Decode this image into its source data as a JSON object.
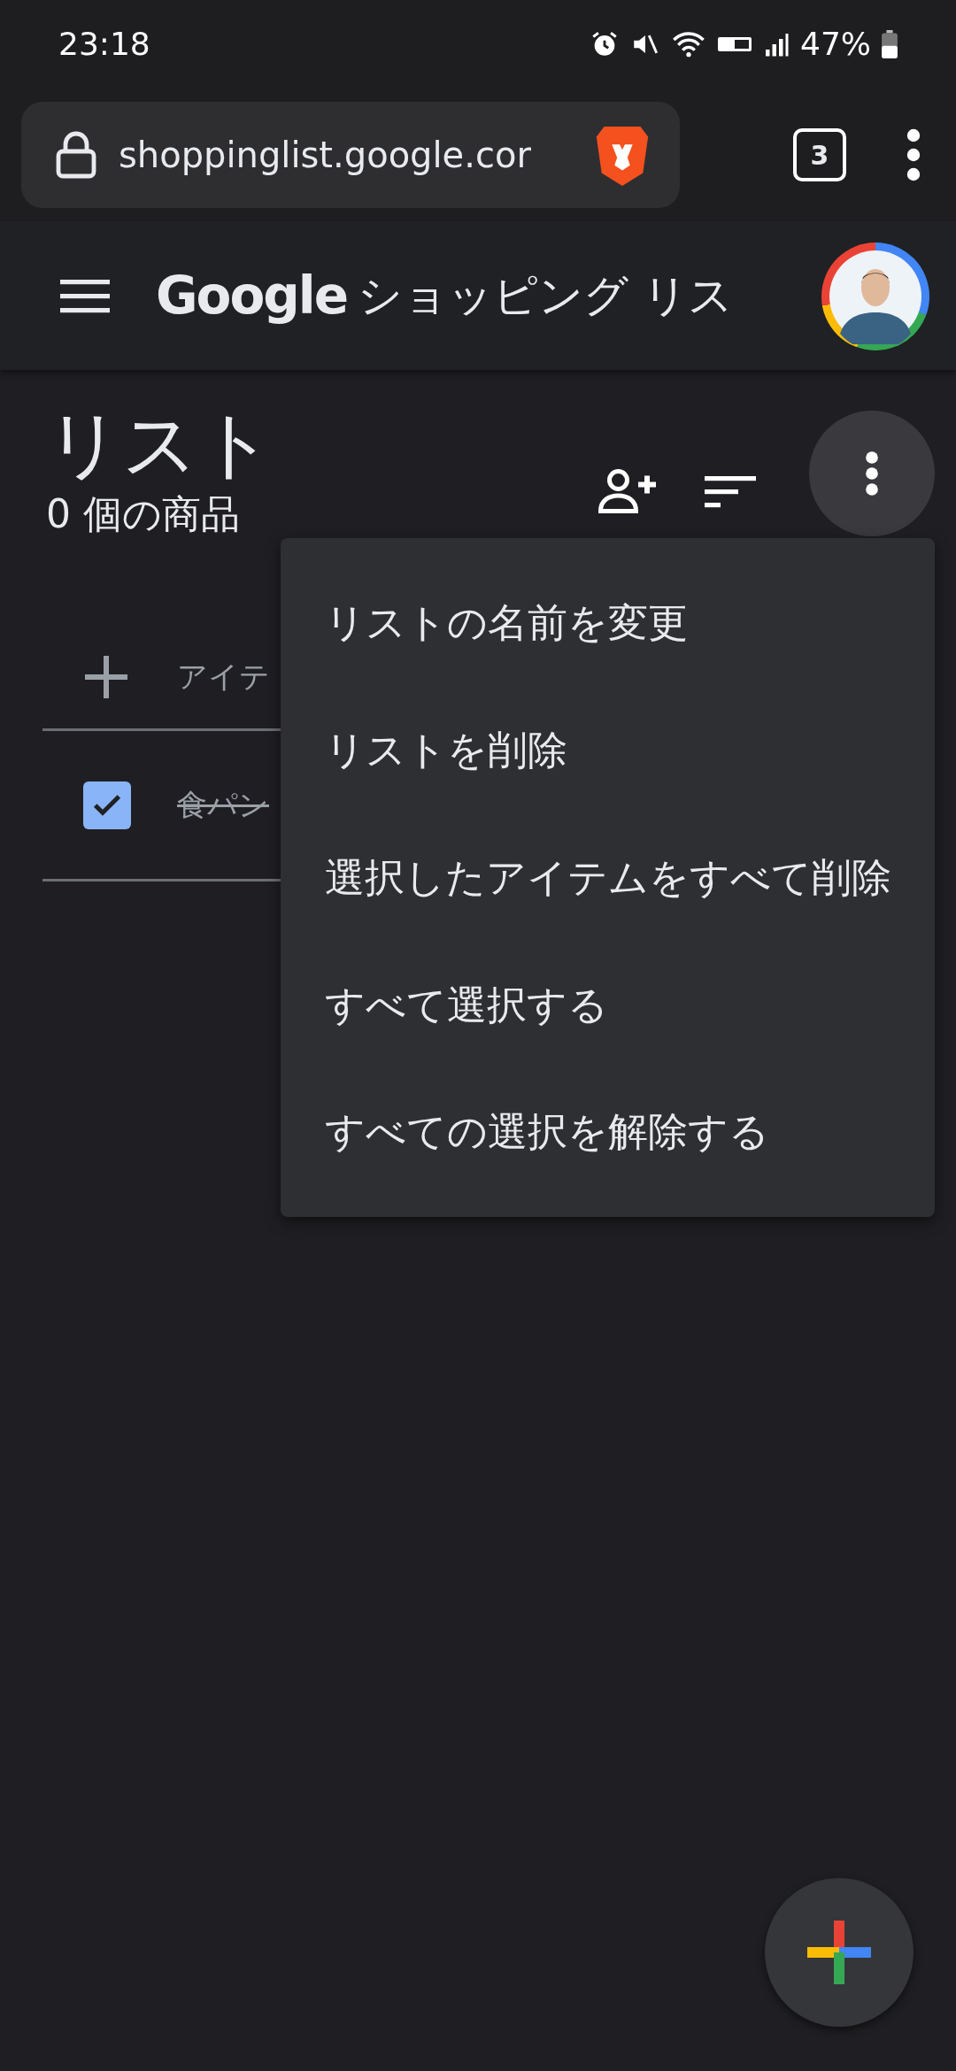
{
  "status_bar": {
    "time": "23:18",
    "battery": "47%"
  },
  "browser": {
    "url": "shoppinglist.google.cor",
    "tab_count": "3"
  },
  "app_bar": {
    "logo": "Google",
    "title": "ショッピング リス"
  },
  "list": {
    "title": "リスト",
    "count": "0 個の商品",
    "add_item": {
      "placeholder": "アイテ"
    },
    "items": [
      {
        "name": "食パン",
        "checked": true
      }
    ]
  },
  "menu": {
    "open": true,
    "items": [
      "リストの名前を変更",
      "リストを削除",
      "選択したアイテムをすべて削除",
      "すべて選択する",
      "すべての選択を解除する"
    ]
  }
}
